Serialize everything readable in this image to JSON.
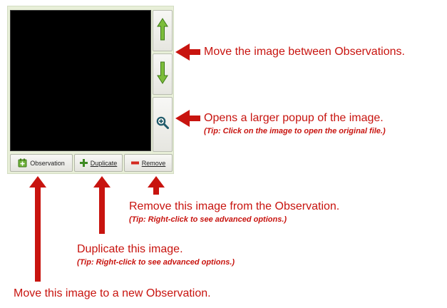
{
  "image_panel": {
    "buttons": {
      "observation_label": "Observation",
      "duplicate_label": "Duplicate",
      "remove_label": "Remove"
    },
    "icons": {
      "move_up": "green-arrow-up-icon",
      "move_down": "green-arrow-down-icon",
      "zoom": "magnifier-plus-icon",
      "observation": "observation-add-icon",
      "duplicate": "plus-icon",
      "remove": "minus-icon"
    }
  },
  "callouts": {
    "move_between": "Move the image between Observations.",
    "popup_main": "Opens a larger popup of the image.",
    "popup_tip": "(Tip: Click on the image to open the original file.)",
    "remove_main": "Remove this image from the Observation.",
    "remove_tip": "(Tip: Right-click to see advanced options.)",
    "duplicate_main": "Duplicate this image.",
    "duplicate_tip": "(Tip: Right-click to see advanced options.)",
    "new_observation": "Move this image to a new Observation."
  },
  "colors": {
    "annotation": "#c8140f",
    "panel_bg": "#e8efd8",
    "arrow_green": "#7cbd3a",
    "remove_red": "#d42a1f",
    "zoom_teal": "#1f5a6a"
  }
}
